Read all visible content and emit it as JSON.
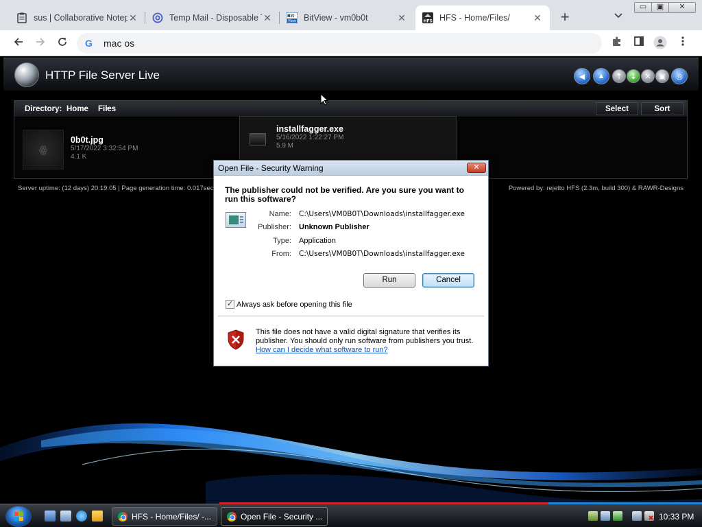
{
  "browser": {
    "tabs": [
      {
        "title": "sus | Collaborative Notepad",
        "icon": "notepad-icon"
      },
      {
        "title": "Temp Mail - Disposable Temporary Email",
        "icon": "at-sign-icon"
      },
      {
        "title": "BitView - vm0b0t",
        "icon": "bitview-icon"
      },
      {
        "title": "HFS - Home/Files/",
        "icon": "hfs-icon",
        "active": true
      }
    ],
    "new_tab": "+",
    "address": "mac os",
    "window_buttons": {
      "minimize": "▭",
      "restore": "▣",
      "close": "✕"
    }
  },
  "hfs": {
    "title": "HTTP File Server Live",
    "directory_label": "Directory:",
    "breadcrumb": [
      "Home",
      "Files"
    ],
    "select_label": "Select",
    "sort_label": "Sort",
    "files": [
      {
        "name": "0b0t.jpg",
        "date": "5/17/2022 3:32:54 PM",
        "size": "4.1 K"
      },
      {
        "name": "installfagger.exe",
        "date": "5/16/2022 1:22:27 PM",
        "size": "5.9 M"
      }
    ],
    "uptime": "Server uptime:  (12 days) 20:19:05   |   Page generation time:  0.017sec",
    "powered_by": "Powered by: rejetto HFS (2.3m, build 300) & RAWR-Designs"
  },
  "dialog": {
    "title": "Open File - Security Warning",
    "heading": "The publisher could not be verified.  Are you sure you want to run this software?",
    "fields": [
      {
        "label": "Name:",
        "value": "C:\\Users\\VM0B0T\\Downloads\\installfagger.exe"
      },
      {
        "label": "Publisher:",
        "value": "Unknown Publisher"
      },
      {
        "label": "Type:",
        "value": "Application"
      },
      {
        "label": "From:",
        "value": "C:\\Users\\VM0B0T\\Downloads\\installfagger.exe"
      }
    ],
    "run_label": "Run",
    "cancel_label": "Cancel",
    "always_ask_label": "Always ask before opening this file",
    "always_ask_checked": true,
    "warning_text": "This file does not have a valid digital signature that verifies its publisher.  You should only run software from publishers you trust.",
    "help_link": "How can I decide what software to run?"
  },
  "taskbar": {
    "tasks": [
      {
        "label": "HFS - Home/Files/ -..."
      },
      {
        "label": "Open File - Security ...",
        "active": true
      }
    ],
    "clock": "10:33 PM"
  },
  "colors": {
    "dialog_link": "#0b52c4",
    "hfs_background": "#000000",
    "taskbar_red_strip": "#c7242a",
    "taskbar_blue_strip": "#1b86d8"
  }
}
